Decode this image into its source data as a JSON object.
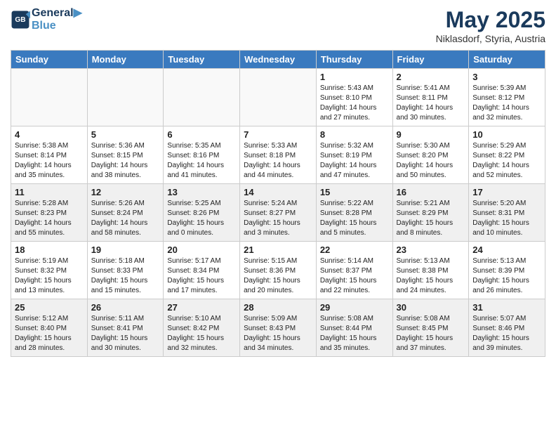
{
  "header": {
    "logo_line1": "General",
    "logo_line2": "Blue",
    "month_title": "May 2025",
    "location": "Niklasdorf, Styria, Austria"
  },
  "weekdays": [
    "Sunday",
    "Monday",
    "Tuesday",
    "Wednesday",
    "Thursday",
    "Friday",
    "Saturday"
  ],
  "weeks": [
    [
      {
        "day": "",
        "info": ""
      },
      {
        "day": "",
        "info": ""
      },
      {
        "day": "",
        "info": ""
      },
      {
        "day": "",
        "info": ""
      },
      {
        "day": "1",
        "info": "Sunrise: 5:43 AM\nSunset: 8:10 PM\nDaylight: 14 hours\nand 27 minutes."
      },
      {
        "day": "2",
        "info": "Sunrise: 5:41 AM\nSunset: 8:11 PM\nDaylight: 14 hours\nand 30 minutes."
      },
      {
        "day": "3",
        "info": "Sunrise: 5:39 AM\nSunset: 8:12 PM\nDaylight: 14 hours\nand 32 minutes."
      }
    ],
    [
      {
        "day": "4",
        "info": "Sunrise: 5:38 AM\nSunset: 8:14 PM\nDaylight: 14 hours\nand 35 minutes."
      },
      {
        "day": "5",
        "info": "Sunrise: 5:36 AM\nSunset: 8:15 PM\nDaylight: 14 hours\nand 38 minutes."
      },
      {
        "day": "6",
        "info": "Sunrise: 5:35 AM\nSunset: 8:16 PM\nDaylight: 14 hours\nand 41 minutes."
      },
      {
        "day": "7",
        "info": "Sunrise: 5:33 AM\nSunset: 8:18 PM\nDaylight: 14 hours\nand 44 minutes."
      },
      {
        "day": "8",
        "info": "Sunrise: 5:32 AM\nSunset: 8:19 PM\nDaylight: 14 hours\nand 47 minutes."
      },
      {
        "day": "9",
        "info": "Sunrise: 5:30 AM\nSunset: 8:20 PM\nDaylight: 14 hours\nand 50 minutes."
      },
      {
        "day": "10",
        "info": "Sunrise: 5:29 AM\nSunset: 8:22 PM\nDaylight: 14 hours\nand 52 minutes."
      }
    ],
    [
      {
        "day": "11",
        "info": "Sunrise: 5:28 AM\nSunset: 8:23 PM\nDaylight: 14 hours\nand 55 minutes."
      },
      {
        "day": "12",
        "info": "Sunrise: 5:26 AM\nSunset: 8:24 PM\nDaylight: 14 hours\nand 58 minutes."
      },
      {
        "day": "13",
        "info": "Sunrise: 5:25 AM\nSunset: 8:26 PM\nDaylight: 15 hours\nand 0 minutes."
      },
      {
        "day": "14",
        "info": "Sunrise: 5:24 AM\nSunset: 8:27 PM\nDaylight: 15 hours\nand 3 minutes."
      },
      {
        "day": "15",
        "info": "Sunrise: 5:22 AM\nSunset: 8:28 PM\nDaylight: 15 hours\nand 5 minutes."
      },
      {
        "day": "16",
        "info": "Sunrise: 5:21 AM\nSunset: 8:29 PM\nDaylight: 15 hours\nand 8 minutes."
      },
      {
        "day": "17",
        "info": "Sunrise: 5:20 AM\nSunset: 8:31 PM\nDaylight: 15 hours\nand 10 minutes."
      }
    ],
    [
      {
        "day": "18",
        "info": "Sunrise: 5:19 AM\nSunset: 8:32 PM\nDaylight: 15 hours\nand 13 minutes."
      },
      {
        "day": "19",
        "info": "Sunrise: 5:18 AM\nSunset: 8:33 PM\nDaylight: 15 hours\nand 15 minutes."
      },
      {
        "day": "20",
        "info": "Sunrise: 5:17 AM\nSunset: 8:34 PM\nDaylight: 15 hours\nand 17 minutes."
      },
      {
        "day": "21",
        "info": "Sunrise: 5:15 AM\nSunset: 8:36 PM\nDaylight: 15 hours\nand 20 minutes."
      },
      {
        "day": "22",
        "info": "Sunrise: 5:14 AM\nSunset: 8:37 PM\nDaylight: 15 hours\nand 22 minutes."
      },
      {
        "day": "23",
        "info": "Sunrise: 5:13 AM\nSunset: 8:38 PM\nDaylight: 15 hours\nand 24 minutes."
      },
      {
        "day": "24",
        "info": "Sunrise: 5:13 AM\nSunset: 8:39 PM\nDaylight: 15 hours\nand 26 minutes."
      }
    ],
    [
      {
        "day": "25",
        "info": "Sunrise: 5:12 AM\nSunset: 8:40 PM\nDaylight: 15 hours\nand 28 minutes."
      },
      {
        "day": "26",
        "info": "Sunrise: 5:11 AM\nSunset: 8:41 PM\nDaylight: 15 hours\nand 30 minutes."
      },
      {
        "day": "27",
        "info": "Sunrise: 5:10 AM\nSunset: 8:42 PM\nDaylight: 15 hours\nand 32 minutes."
      },
      {
        "day": "28",
        "info": "Sunrise: 5:09 AM\nSunset: 8:43 PM\nDaylight: 15 hours\nand 34 minutes."
      },
      {
        "day": "29",
        "info": "Sunrise: 5:08 AM\nSunset: 8:44 PM\nDaylight: 15 hours\nand 35 minutes."
      },
      {
        "day": "30",
        "info": "Sunrise: 5:08 AM\nSunset: 8:45 PM\nDaylight: 15 hours\nand 37 minutes."
      },
      {
        "day": "31",
        "info": "Sunrise: 5:07 AM\nSunset: 8:46 PM\nDaylight: 15 hours\nand 39 minutes."
      }
    ]
  ]
}
